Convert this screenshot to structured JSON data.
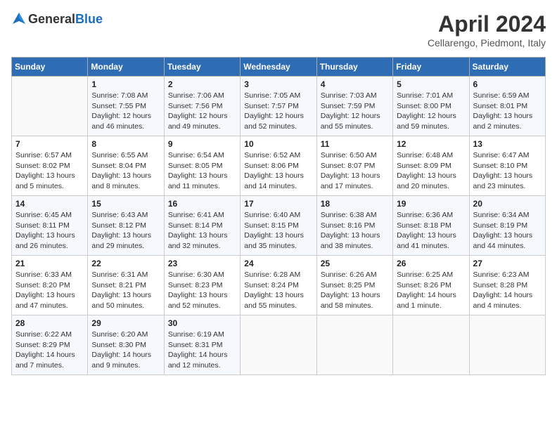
{
  "header": {
    "logo_general": "General",
    "logo_blue": "Blue",
    "month": "April 2024",
    "location": "Cellarengo, Piedmont, Italy"
  },
  "weekdays": [
    "Sunday",
    "Monday",
    "Tuesday",
    "Wednesday",
    "Thursday",
    "Friday",
    "Saturday"
  ],
  "weeks": [
    [
      {
        "day": "",
        "sunrise": "",
        "sunset": "",
        "daylight": ""
      },
      {
        "day": "1",
        "sunrise": "Sunrise: 7:08 AM",
        "sunset": "Sunset: 7:55 PM",
        "daylight": "Daylight: 12 hours and 46 minutes."
      },
      {
        "day": "2",
        "sunrise": "Sunrise: 7:06 AM",
        "sunset": "Sunset: 7:56 PM",
        "daylight": "Daylight: 12 hours and 49 minutes."
      },
      {
        "day": "3",
        "sunrise": "Sunrise: 7:05 AM",
        "sunset": "Sunset: 7:57 PM",
        "daylight": "Daylight: 12 hours and 52 minutes."
      },
      {
        "day": "4",
        "sunrise": "Sunrise: 7:03 AM",
        "sunset": "Sunset: 7:59 PM",
        "daylight": "Daylight: 12 hours and 55 minutes."
      },
      {
        "day": "5",
        "sunrise": "Sunrise: 7:01 AM",
        "sunset": "Sunset: 8:00 PM",
        "daylight": "Daylight: 12 hours and 59 minutes."
      },
      {
        "day": "6",
        "sunrise": "Sunrise: 6:59 AM",
        "sunset": "Sunset: 8:01 PM",
        "daylight": "Daylight: 13 hours and 2 minutes."
      }
    ],
    [
      {
        "day": "7",
        "sunrise": "Sunrise: 6:57 AM",
        "sunset": "Sunset: 8:02 PM",
        "daylight": "Daylight: 13 hours and 5 minutes."
      },
      {
        "day": "8",
        "sunrise": "Sunrise: 6:55 AM",
        "sunset": "Sunset: 8:04 PM",
        "daylight": "Daylight: 13 hours and 8 minutes."
      },
      {
        "day": "9",
        "sunrise": "Sunrise: 6:54 AM",
        "sunset": "Sunset: 8:05 PM",
        "daylight": "Daylight: 13 hours and 11 minutes."
      },
      {
        "day": "10",
        "sunrise": "Sunrise: 6:52 AM",
        "sunset": "Sunset: 8:06 PM",
        "daylight": "Daylight: 13 hours and 14 minutes."
      },
      {
        "day": "11",
        "sunrise": "Sunrise: 6:50 AM",
        "sunset": "Sunset: 8:07 PM",
        "daylight": "Daylight: 13 hours and 17 minutes."
      },
      {
        "day": "12",
        "sunrise": "Sunrise: 6:48 AM",
        "sunset": "Sunset: 8:09 PM",
        "daylight": "Daylight: 13 hours and 20 minutes."
      },
      {
        "day": "13",
        "sunrise": "Sunrise: 6:47 AM",
        "sunset": "Sunset: 8:10 PM",
        "daylight": "Daylight: 13 hours and 23 minutes."
      }
    ],
    [
      {
        "day": "14",
        "sunrise": "Sunrise: 6:45 AM",
        "sunset": "Sunset: 8:11 PM",
        "daylight": "Daylight: 13 hours and 26 minutes."
      },
      {
        "day": "15",
        "sunrise": "Sunrise: 6:43 AM",
        "sunset": "Sunset: 8:12 PM",
        "daylight": "Daylight: 13 hours and 29 minutes."
      },
      {
        "day": "16",
        "sunrise": "Sunrise: 6:41 AM",
        "sunset": "Sunset: 8:14 PM",
        "daylight": "Daylight: 13 hours and 32 minutes."
      },
      {
        "day": "17",
        "sunrise": "Sunrise: 6:40 AM",
        "sunset": "Sunset: 8:15 PM",
        "daylight": "Daylight: 13 hours and 35 minutes."
      },
      {
        "day": "18",
        "sunrise": "Sunrise: 6:38 AM",
        "sunset": "Sunset: 8:16 PM",
        "daylight": "Daylight: 13 hours and 38 minutes."
      },
      {
        "day": "19",
        "sunrise": "Sunrise: 6:36 AM",
        "sunset": "Sunset: 8:18 PM",
        "daylight": "Daylight: 13 hours and 41 minutes."
      },
      {
        "day": "20",
        "sunrise": "Sunrise: 6:34 AM",
        "sunset": "Sunset: 8:19 PM",
        "daylight": "Daylight: 13 hours and 44 minutes."
      }
    ],
    [
      {
        "day": "21",
        "sunrise": "Sunrise: 6:33 AM",
        "sunset": "Sunset: 8:20 PM",
        "daylight": "Daylight: 13 hours and 47 minutes."
      },
      {
        "day": "22",
        "sunrise": "Sunrise: 6:31 AM",
        "sunset": "Sunset: 8:21 PM",
        "daylight": "Daylight: 13 hours and 50 minutes."
      },
      {
        "day": "23",
        "sunrise": "Sunrise: 6:30 AM",
        "sunset": "Sunset: 8:23 PM",
        "daylight": "Daylight: 13 hours and 52 minutes."
      },
      {
        "day": "24",
        "sunrise": "Sunrise: 6:28 AM",
        "sunset": "Sunset: 8:24 PM",
        "daylight": "Daylight: 13 hours and 55 minutes."
      },
      {
        "day": "25",
        "sunrise": "Sunrise: 6:26 AM",
        "sunset": "Sunset: 8:25 PM",
        "daylight": "Daylight: 13 hours and 58 minutes."
      },
      {
        "day": "26",
        "sunrise": "Sunrise: 6:25 AM",
        "sunset": "Sunset: 8:26 PM",
        "daylight": "Daylight: 14 hours and 1 minute."
      },
      {
        "day": "27",
        "sunrise": "Sunrise: 6:23 AM",
        "sunset": "Sunset: 8:28 PM",
        "daylight": "Daylight: 14 hours and 4 minutes."
      }
    ],
    [
      {
        "day": "28",
        "sunrise": "Sunrise: 6:22 AM",
        "sunset": "Sunset: 8:29 PM",
        "daylight": "Daylight: 14 hours and 7 minutes."
      },
      {
        "day": "29",
        "sunrise": "Sunrise: 6:20 AM",
        "sunset": "Sunset: 8:30 PM",
        "daylight": "Daylight: 14 hours and 9 minutes."
      },
      {
        "day": "30",
        "sunrise": "Sunrise: 6:19 AM",
        "sunset": "Sunset: 8:31 PM",
        "daylight": "Daylight: 14 hours and 12 minutes."
      },
      {
        "day": "",
        "sunrise": "",
        "sunset": "",
        "daylight": ""
      },
      {
        "day": "",
        "sunrise": "",
        "sunset": "",
        "daylight": ""
      },
      {
        "day": "",
        "sunrise": "",
        "sunset": "",
        "daylight": ""
      },
      {
        "day": "",
        "sunrise": "",
        "sunset": "",
        "daylight": ""
      }
    ]
  ]
}
